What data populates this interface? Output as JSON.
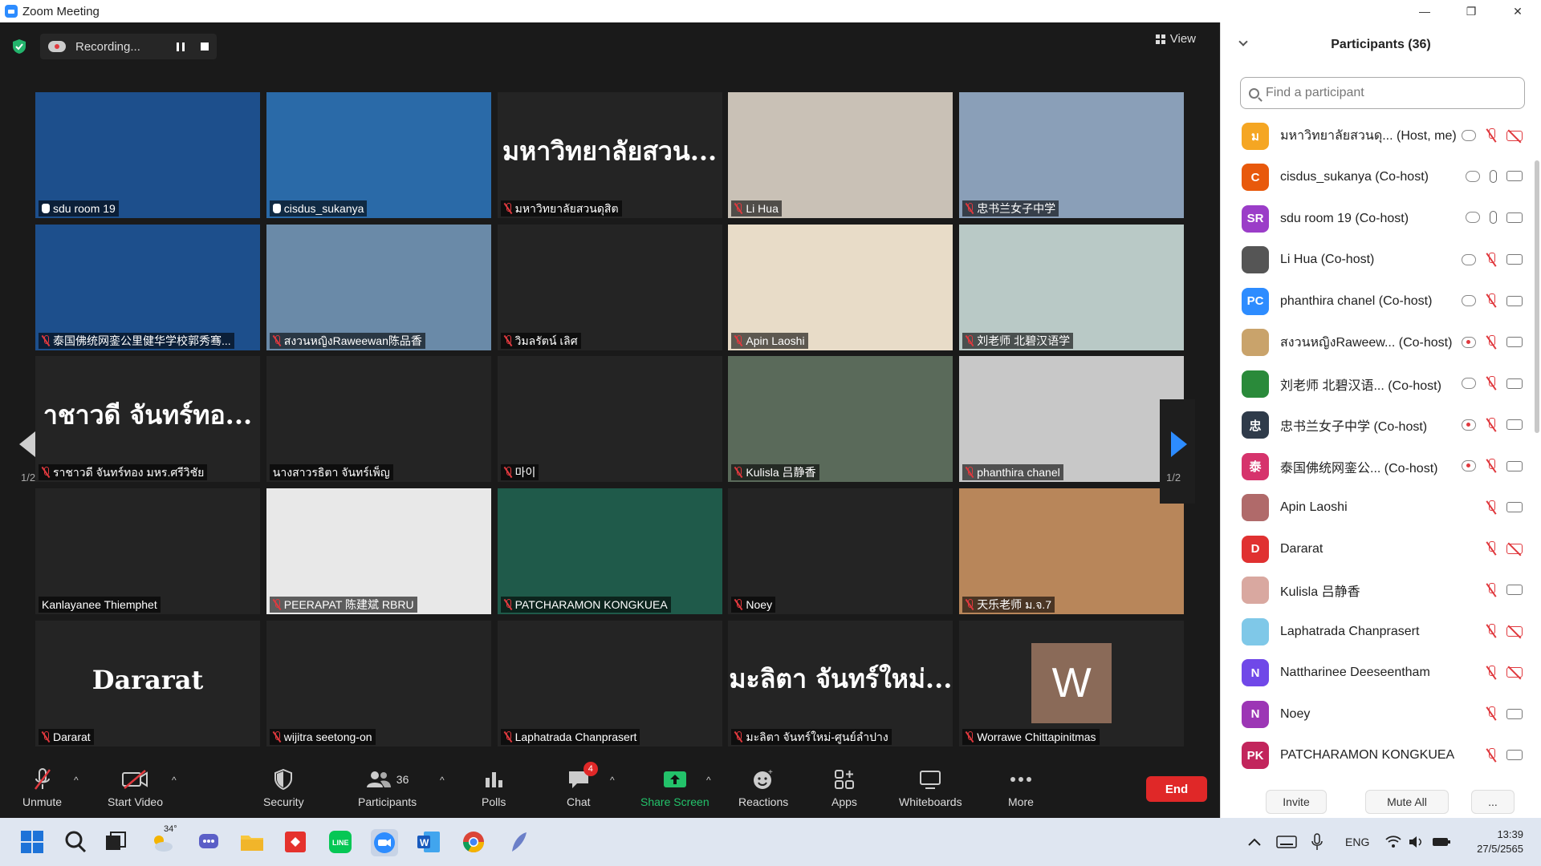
{
  "window": {
    "title": "Zoom Meeting",
    "minimize": "—",
    "maximize": "❐",
    "close": "✕"
  },
  "recording": {
    "label": "Recording..."
  },
  "view": {
    "label": "View"
  },
  "pagination": {
    "left": "1/2",
    "right": "1/2"
  },
  "tiles": [
    {
      "name": "sdu room 19",
      "icon": "hand",
      "bg": "#1d4f8c"
    },
    {
      "name": "cisdus_sukanya",
      "icon": "hand",
      "bg": "#2a6aa8",
      "active": true
    },
    {
      "name": "มหาวิทยาลัยสวนดุสิต",
      "icon": "mic-off",
      "big": "มหาวิทยาลัยสวน...",
      "bg": "#242424"
    },
    {
      "name": "Li Hua",
      "icon": "mic-off",
      "bg": "#c9c1b6"
    },
    {
      "name": "忠书兰女子中学",
      "icon": "mic-off",
      "bg": "#8a9fb8"
    },
    {
      "name": "泰国佛统网銮公里健华学校郭秀骞...",
      "icon": "mic-off",
      "bg": "#1d4f8c"
    },
    {
      "name": "สงวนหญิงRaweewan陈品香",
      "icon": "mic-off",
      "bg": "#6a8aa8"
    },
    {
      "name": "วิมลรัตน์ เลิศ",
      "icon": "mic-off",
      "bg": "#242424"
    },
    {
      "name": "Apin Laoshi",
      "icon": "mic-off",
      "bg": "#e8dcc8"
    },
    {
      "name": "刘老师 北碧汉语学",
      "icon": "mic-off",
      "bg": "#b9c9c6"
    },
    {
      "name": "ราชาวดี จันทร์ทอง มหร.ศรีวิชัย",
      "icon": "mic-off",
      "big": "าชาวดี จันทร์ทอ...",
      "bg": "#242424"
    },
    {
      "name": "นางสาวรธิตา จันทร์เพ็ญ",
      "icon": "none",
      "bg": "#242424"
    },
    {
      "name": "마이",
      "icon": "mic-off",
      "bg": "#242424"
    },
    {
      "name": "Kulisla 吕静香",
      "icon": "mic-off",
      "bg": "#5a6a5a"
    },
    {
      "name": "phanthira chanel",
      "icon": "mic-off",
      "bg": "#c8c8c8"
    },
    {
      "name": "Kanlayanee Thiemphet",
      "icon": "none",
      "bg": "#242424"
    },
    {
      "name": "PEERAPAT 陈建斌 RBRU",
      "icon": "mic-off",
      "bg": "#e8e8e8"
    },
    {
      "name": "PATCHARAMON KONGKUEA",
      "icon": "mic-off",
      "bg": "#1f5a4a"
    },
    {
      "name": "Noey",
      "icon": "mic-off",
      "bg": "#242424"
    },
    {
      "name": "天乐老师 ม.จ.7",
      "icon": "mic-off",
      "bg": "#b8865a"
    },
    {
      "name": "Dararat",
      "icon": "mic-off",
      "big": "Dararat",
      "bg": "#242424"
    },
    {
      "name": "wijitra seetong-on",
      "icon": "mic-off",
      "bg": "#242424"
    },
    {
      "name": "Laphatrada Chanprasert",
      "icon": "mic-off",
      "bg": "#242424"
    },
    {
      "name": "มะลิตา จันทร์ใหม่-ศูนย์ลำปาง",
      "icon": "mic-off",
      "big": "มะลิตา จันทร์ใหม่...",
      "bg": "#242424"
    },
    {
      "name": "Worrawe Chittapinitmas",
      "icon": "mic-off",
      "avatar": "W",
      "bg": "#242424"
    }
  ],
  "toolbar": {
    "unmute": "Unmute",
    "start_video": "Start Video",
    "security": "Security",
    "participants": "Participants",
    "participants_count": "36",
    "polls": "Polls",
    "chat": "Chat",
    "chat_badge": "4",
    "share_screen": "Share Screen",
    "reactions": "Reactions",
    "apps": "Apps",
    "whiteboards": "Whiteboards",
    "more": "More",
    "end": "End"
  },
  "panel": {
    "title": "Participants (36)",
    "search_placeholder": "Find a participant",
    "invite": "Invite",
    "mute_all": "Mute All",
    "more": "...",
    "participants": [
      {
        "initial": "ม",
        "color": "#f5a623",
        "name": "มหาวิทยาลัยสวนดุ...  (Host, me)",
        "cloud": true,
        "mic": "off",
        "video": "off"
      },
      {
        "initial": "C",
        "color": "#e8590c",
        "name": "cisdus_sukanya (Co-host)",
        "cloud": true,
        "mic": "on",
        "video": "on"
      },
      {
        "initial": "SR",
        "color": "#9b3dc8",
        "name": "sdu room 19 (Co-host)",
        "cloud": true,
        "mic": "on",
        "video": "on"
      },
      {
        "initial": "",
        "color": "#555555",
        "name": "Li Hua (Co-host)",
        "cloud": true,
        "mic": "off",
        "video": "on"
      },
      {
        "initial": "PC",
        "color": "#2d8cff",
        "name": "phanthira chanel (Co-host)",
        "cloud": true,
        "mic": "off",
        "video": "on"
      },
      {
        "initial": "",
        "color": "#c9a36b",
        "name": "สงวนหญิงRaweew...  (Co-host)",
        "cloud": "red",
        "mic": "off",
        "video": "on"
      },
      {
        "initial": "",
        "color": "#2a8a3a",
        "name": "刘老师 北碧汉语...  (Co-host)",
        "cloud": true,
        "mic": "off",
        "video": "on"
      },
      {
        "initial": "忠",
        "color": "#2f3b4a",
        "name": "忠书兰女子中学 (Co-host)",
        "cloud": "red",
        "mic": "off",
        "video": "on"
      },
      {
        "initial": "泰",
        "color": "#d6336c",
        "name": "泰国佛统网銮公...  (Co-host)",
        "cloud": "red",
        "mic": "off",
        "video": "on"
      },
      {
        "initial": "",
        "color": "#b06a6a",
        "name": "Apin Laoshi",
        "cloud": false,
        "mic": "off",
        "video": "on"
      },
      {
        "initial": "D",
        "color": "#e03131",
        "name": "Dararat",
        "cloud": false,
        "mic": "off",
        "video": "off"
      },
      {
        "initial": "",
        "color": "#d9a8a0",
        "name": "Kulisla 吕静香",
        "cloud": false,
        "mic": "off",
        "video": "on"
      },
      {
        "initial": "",
        "color": "#7fc8e8",
        "name": "Laphatrada Chanprasert",
        "cloud": false,
        "mic": "off",
        "video": "off"
      },
      {
        "initial": "N",
        "color": "#7048e8",
        "name": "Nattharinee Deeseentham",
        "cloud": false,
        "mic": "off",
        "video": "off"
      },
      {
        "initial": "N",
        "color": "#9c36b5",
        "name": "Noey",
        "cloud": false,
        "mic": "off",
        "video": "on"
      },
      {
        "initial": "PK",
        "color": "#c2255c",
        "name": "PATCHARAMON KONGKUEA",
        "cloud": false,
        "mic": "off",
        "video": "on"
      }
    ]
  },
  "taskbar": {
    "weather": "34°",
    "lang": "ENG",
    "time": "13:39",
    "date": "27/5/2565"
  }
}
